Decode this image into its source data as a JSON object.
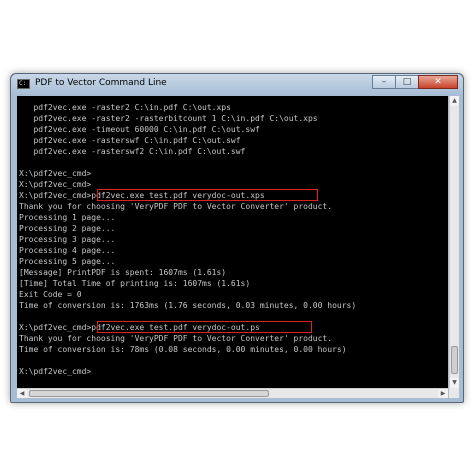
{
  "window": {
    "title": "PDF to Vector Command Line",
    "icon": "console-icon",
    "controls": {
      "minimize": "–",
      "maximize": "□",
      "close": "✕"
    }
  },
  "console": {
    "lines": [
      "   pdf2vec.exe -raster2 C:\\in.pdf C:\\out.xps",
      "   pdf2vec.exe -raster2 -rasterbitcount 1 C:\\in.pdf C:\\out.xps",
      "   pdf2vec.exe -timeout 60000 C:\\in.pdf C:\\out.swf",
      "   pdf2vec.exe -rasterswf C:\\in.pdf C:\\out.swf",
      "   pdf2vec.exe -rasterswf2 C:\\in.pdf C:\\out.swf",
      "",
      "X:\\pdf2vec_cmd>",
      "X:\\pdf2vec_cmd>",
      "X:\\pdf2vec_cmd>pdf2vec.exe test.pdf verydoc-out.xps",
      "Thank you for choosing 'VeryPDF PDF to Vector Converter' product.",
      "Processing 1 page...",
      "Processing 2 page...",
      "Processing 3 page...",
      "Processing 4 page...",
      "Processing 5 page...",
      "[Message] PrintPDF is spent: 1607ms (1.61s)",
      "[Time] Total Time of printing is: 1607ms (1.61s)",
      "Exit Code = 0",
      "Time of conversion is: 1763ms (1.76 seconds, 0.03 minutes, 0.00 hours)",
      "",
      "X:\\pdf2vec_cmd>pdf2vec.exe test.pdf verydoc-out.ps",
      "Thank you for choosing 'VeryPDF PDF to Vector Converter' product.",
      "Time of conversion is: 78ms (0.08 seconds, 0.00 minutes, 0.00 hours)",
      "",
      "X:\\pdf2vec_cmd>"
    ]
  },
  "scrollbars": {
    "up": "▲",
    "down": "▼",
    "left": "◀",
    "right": "▶",
    "grip": "≡"
  }
}
